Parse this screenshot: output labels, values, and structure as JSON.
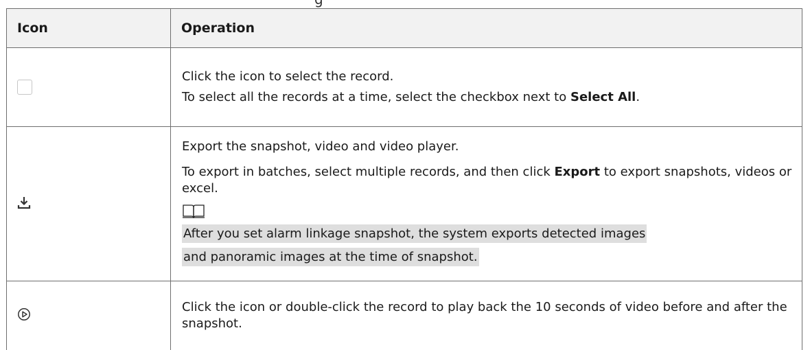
{
  "caption_fragment": "g",
  "table": {
    "headers": {
      "icon": "Icon",
      "operation": "Operation"
    },
    "rows": [
      {
        "icon": "checkbox-icon",
        "lines": [
          {
            "text": "Click the icon to select the record."
          },
          {
            "before": "To select all the records at a time, select the checkbox next to ",
            "bold": "Select All",
            "after": "."
          }
        ]
      },
      {
        "icon": "download-icon",
        "lines": [
          {
            "text": "Export the snapshot, video and video player."
          },
          {
            "before": "To export in batches, select multiple records, and then click ",
            "bold": "Export",
            "after": " to export snapshots, videos or excel."
          }
        ],
        "note_icon": "book-icon",
        "note": {
          "line1": "After you set alarm linkage snapshot, the system exports detected images",
          "line2": "and panoramic images at the time of snapshot."
        }
      },
      {
        "icon": "play-circle-icon",
        "lines": [
          {
            "text": "Click the icon or double-click the record to play back the 10 seconds of video before and after the snapshot."
          }
        ]
      }
    ]
  }
}
